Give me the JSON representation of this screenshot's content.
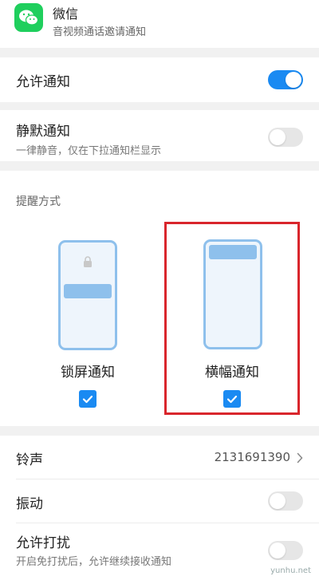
{
  "app": {
    "name": "微信",
    "subtitle": "音视频通话邀请通知",
    "icon": "wechat-icon",
    "icon_color": "#1fcf5d"
  },
  "allow_notifications": {
    "label": "允许通知",
    "enabled": true
  },
  "silent_notifications": {
    "label": "静默通知",
    "description": "一律静音，仅在下拉通知栏显示",
    "enabled": false
  },
  "reminder": {
    "section_label": "提醒方式",
    "options": [
      {
        "label": "锁屏通知",
        "checked": true,
        "icon": "lock-icon"
      },
      {
        "label": "横幅通知",
        "checked": true
      }
    ]
  },
  "ringtone": {
    "label": "铃声",
    "value": "2131691390"
  },
  "vibration": {
    "label": "振动",
    "enabled": false
  },
  "allow_interrupt": {
    "label": "允许打扰",
    "description": "开启免打扰后，允许继续接收通知",
    "enabled": false
  },
  "watermark": "yunhu.net",
  "colors": {
    "accent": "#1a8af2",
    "highlight_border": "#d9262c",
    "phone_frame": "#8ec0ec"
  }
}
